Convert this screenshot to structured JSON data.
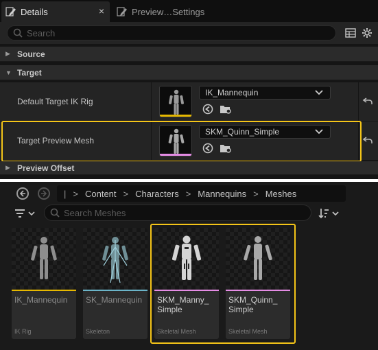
{
  "details_tab": {
    "label": "Details",
    "close": "×"
  },
  "preview_tab": {
    "label": "Preview…Settings"
  },
  "search": {
    "placeholder": "Search"
  },
  "categories": {
    "source": "Source",
    "target": "Target",
    "preview_offset": "Preview Offset"
  },
  "properties": [
    {
      "label": "Default Target IK Rig",
      "value": "IK_Mannequin",
      "bar_color": "#e6b800"
    },
    {
      "label": "Target Preview Mesh",
      "value": "SKM_Quinn_Simple",
      "bar_color": "#e58ce5"
    }
  ],
  "breadcrumb": {
    "root": "|",
    "items": [
      "Content",
      "Characters",
      "Mannequins",
      "Meshes"
    ],
    "separator": ">"
  },
  "asset_search": {
    "placeholder": "Search Meshes"
  },
  "assets": [
    {
      "name": "IK_Mannequin",
      "type": "IK Rig",
      "bar_color": "#e6b800"
    },
    {
      "name": "SK_Mannequin",
      "type": "Skeleton",
      "bar_color": "#6bb4c8"
    },
    {
      "name": "SKM_Manny_ Simple",
      "type": "Skeletal Mesh",
      "bar_color": "#e58ce5"
    },
    {
      "name": "SKM_Quinn_ Simple",
      "type": "Skeletal Mesh",
      "bar_color": "#e58ce5"
    }
  ],
  "colors": {
    "highlight": "#f5c518",
    "ikrig": "#e6b800",
    "skeleton": "#6bb4c8",
    "skeletal_mesh": "#e58ce5"
  }
}
